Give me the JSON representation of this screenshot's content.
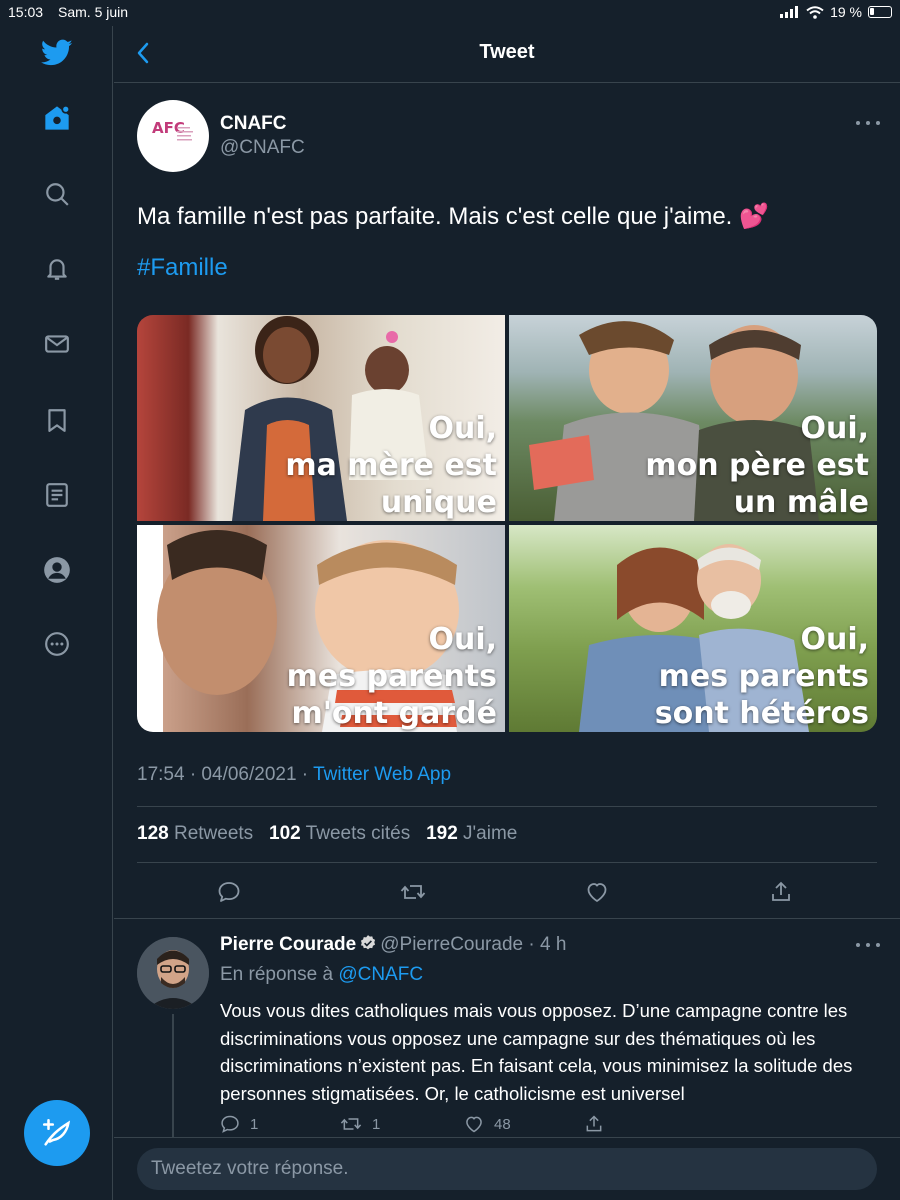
{
  "status_bar": {
    "time": "15:03",
    "date": "Sam. 5 juin",
    "battery": "19 %"
  },
  "colors": {
    "background": "#15202b",
    "accent": "#1d9bf0",
    "secondary_text": "#8b98a5",
    "border": "#38444d"
  },
  "sidebar": {
    "items": [
      {
        "icon": "twitter-bird-icon"
      },
      {
        "icon": "home-icon"
      },
      {
        "icon": "search-icon"
      },
      {
        "icon": "bell-icon"
      },
      {
        "icon": "mail-icon"
      },
      {
        "icon": "bookmark-icon"
      },
      {
        "icon": "list-icon"
      },
      {
        "icon": "profile-icon"
      },
      {
        "icon": "more-circle-icon"
      }
    ],
    "compose_icon": "compose-feather-icon"
  },
  "header": {
    "title": "Tweet",
    "back_icon": "chevron-left-icon"
  },
  "tweet": {
    "author": {
      "name": "CNAFC",
      "handle": "@CNAFC",
      "avatar_logo": "AFC"
    },
    "text": "Ma famille n'est pas parfaite. Mais c'est celle que j'aime. 💕",
    "hashtag": "#Famille",
    "media": [
      {
        "caption": [
          "Oui,",
          "ma mère est",
          "unique"
        ]
      },
      {
        "caption": [
          "Oui,",
          "mon père est",
          "un mâle"
        ]
      },
      {
        "caption": [
          "Oui,",
          "mes parents",
          "m'ont gardé"
        ]
      },
      {
        "caption": [
          "Oui,",
          "mes parents",
          "sont hétéros"
        ]
      }
    ],
    "timestamp": "17:54 · 04/06/2021 · ",
    "source": "Twitter Web App",
    "stats": {
      "retweets_count": "128",
      "retweets_label": "Retweets",
      "quotes_count": "102",
      "quotes_label": "Tweets cités",
      "likes_count": "192",
      "likes_label": "J'aime"
    },
    "actions": [
      "reply-icon",
      "retweet-icon",
      "like-icon",
      "share-icon"
    ]
  },
  "reply": {
    "name": "Pierre Courade",
    "handle": "@PierreCourade",
    "time": "· 4 h",
    "in_reply_prefix": "En réponse à ",
    "in_reply_to": "@CNAFC",
    "text": "Vous vous dites catholiques mais vous opposez. D’une campagne contre les discriminations vous opposez une campagne sur des thématiques où les discriminations n’existent pas. En faisant cela, vous minimisez la solitude des personnes stigmatisées. Or, le catholicisme est universel",
    "reply_count": "1",
    "retweet_count": "1",
    "like_count": "48"
  },
  "composer": {
    "placeholder": "Tweetez votre réponse."
  }
}
